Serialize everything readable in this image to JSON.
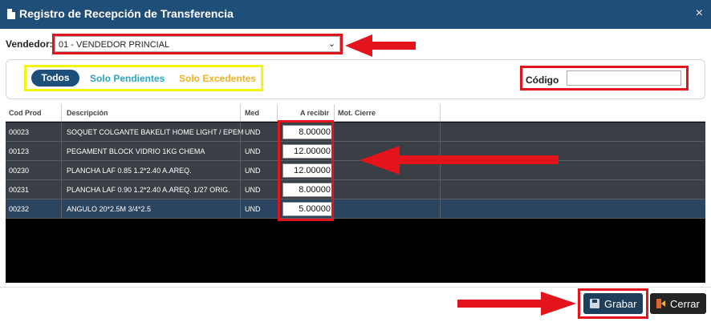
{
  "window": {
    "title": "Registro de Recepción de Transferencia",
    "close_glyph": "×"
  },
  "vendedor": {
    "label": "Vendedor:",
    "selected": "01 - VENDEDOR PRINCIAL"
  },
  "filters": {
    "all": "Todos",
    "pending": "Solo Pendientes",
    "excess": "Solo Excedentes",
    "active": "Todos"
  },
  "codigo": {
    "label": "Código",
    "value": ""
  },
  "table": {
    "headers": {
      "cod": "Cod Prod",
      "desc": "Descripción",
      "med": "Med",
      "recibir": "A recibir",
      "motivo": "Mot. Cierre"
    },
    "rows": [
      {
        "cod": "00023",
        "desc": "SOQUET COLGANTE BAKELIT HOME LIGHT / EPEM",
        "med": "UND",
        "recibir": "8.00000",
        "motivo": ""
      },
      {
        "cod": "00123",
        "desc": "PEGAMENT BLOCK VIDRIO 1KG CHEMA",
        "med": "UND",
        "recibir": "12.00000",
        "motivo": ""
      },
      {
        "cod": "00230",
        "desc": "PLANCHA LAF 0.85 1.2*2.40 A.AREQ.",
        "med": "UND",
        "recibir": "12.00000",
        "motivo": ""
      },
      {
        "cod": "00231",
        "desc": "PLANCHA LAF 0.90 1.2*2.40 A.AREQ. 1/27 ORIG.",
        "med": "UND",
        "recibir": "8.00000",
        "motivo": ""
      },
      {
        "cod": "00232",
        "desc": "ANGULO 20*2.5M 3/4*2.5",
        "med": "UND",
        "recibir": "5.00000",
        "motivo": ""
      }
    ]
  },
  "buttons": {
    "save": "Grabar",
    "close": "Cerrar"
  },
  "colors": {
    "titlebar": "#1f4e79",
    "annotation_red": "#e3141b",
    "annotation_yellow": "#f4f40c",
    "row_dark": "#3a3f46",
    "row_selected": "#2b4560"
  }
}
